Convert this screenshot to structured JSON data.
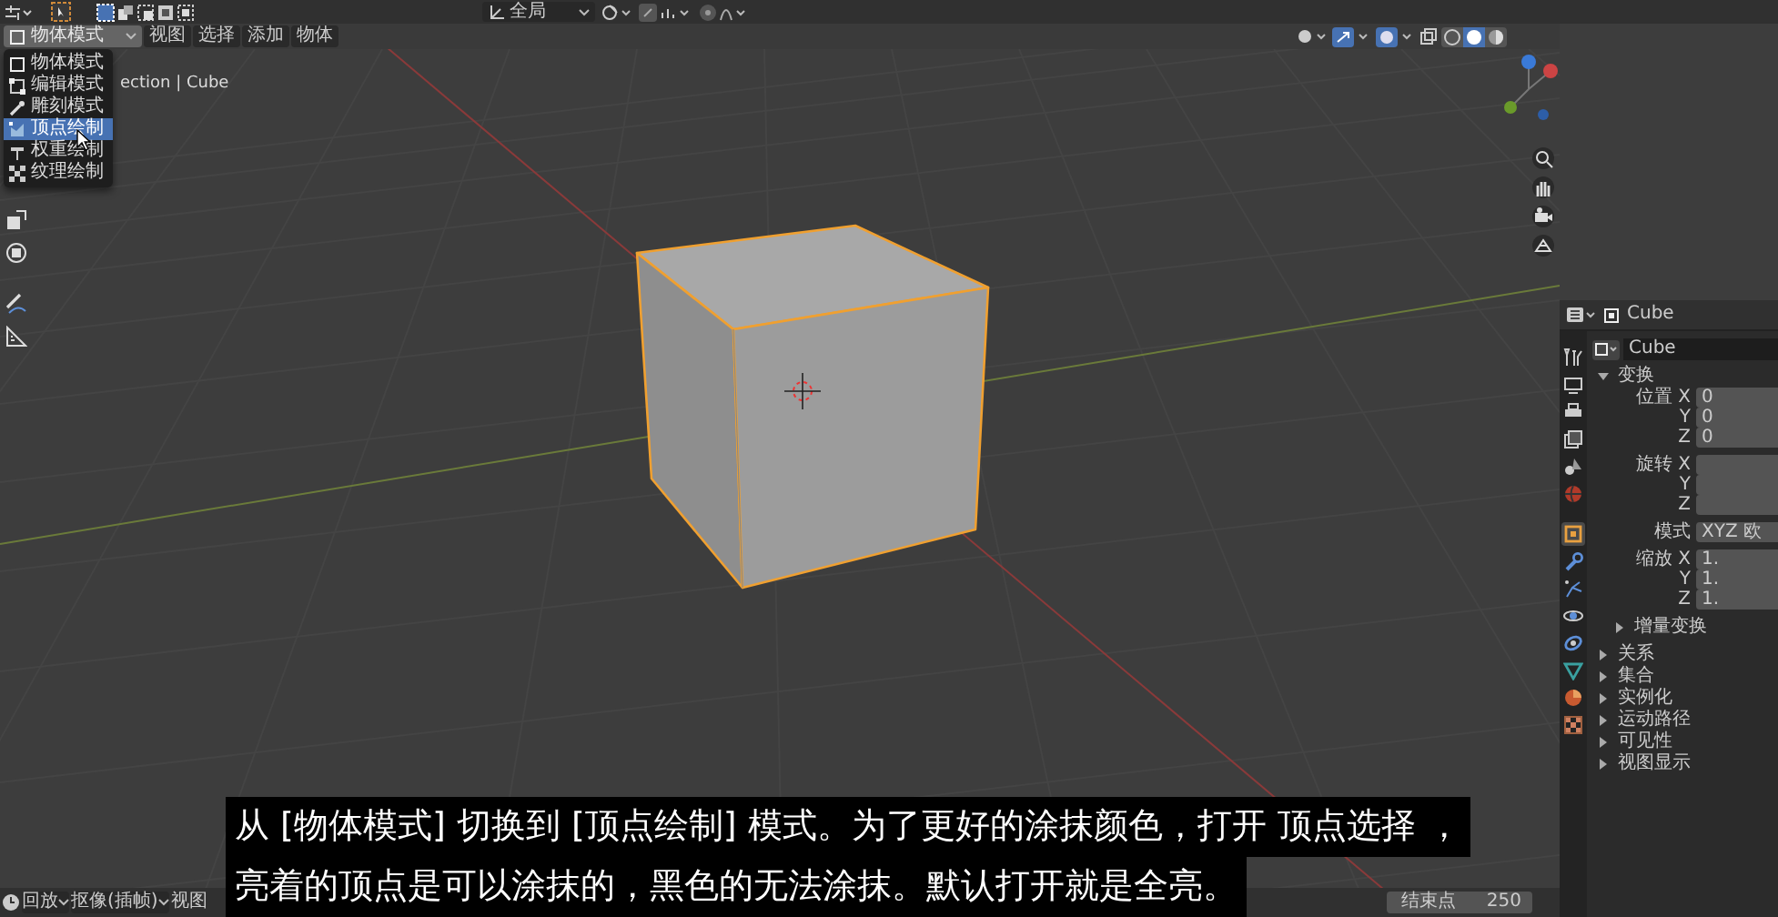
{
  "topbar": {
    "transform_orientation": "全局"
  },
  "mode_dropdown": {
    "value": "物体模式",
    "expanded": true
  },
  "mode_menu": [
    {
      "label": "物体模式",
      "kind": "object",
      "selected": false
    },
    {
      "label": "编辑模式",
      "kind": "edit",
      "selected": false
    },
    {
      "label": "雕刻模式",
      "kind": "sculpt",
      "selected": false
    },
    {
      "label": "顶点绘制",
      "kind": "vertex_paint",
      "selected": true
    },
    {
      "label": "权重绘制",
      "kind": "weight_paint",
      "selected": false
    },
    {
      "label": "纹理绘制",
      "kind": "texture_paint",
      "selected": false
    }
  ],
  "header_menus": [
    "视图",
    "选择",
    "添加",
    "物体"
  ],
  "viewport": {
    "info_text": "ection | Cube"
  },
  "properties": {
    "object_name": "Cube",
    "data_name": "Cube",
    "tabs": [
      {
        "kind": "tool",
        "selected": false
      },
      {
        "kind": "render",
        "selected": false
      },
      {
        "kind": "output",
        "selected": false
      },
      {
        "kind": "view_layer",
        "selected": false
      },
      {
        "kind": "scene",
        "selected": false
      },
      {
        "kind": "world",
        "selected": false
      },
      {
        "kind": "object",
        "selected": true
      },
      {
        "kind": "modifier",
        "selected": false
      },
      {
        "kind": "particles",
        "selected": false
      },
      {
        "kind": "physics",
        "selected": false
      },
      {
        "kind": "constraints",
        "selected": false
      },
      {
        "kind": "data",
        "selected": false
      },
      {
        "kind": "material",
        "selected": false
      },
      {
        "kind": "texture",
        "selected": false
      }
    ],
    "transform": {
      "title": "变换",
      "expanded": true,
      "groups": [
        {
          "rows": [
            {
              "label": "位置 X",
              "value": "0"
            },
            {
              "label": "Y",
              "value": "0"
            },
            {
              "label": "Z",
              "value": "0"
            }
          ]
        },
        {
          "rows": [
            {
              "label": "旋转 X"
            },
            {
              "label": "Y"
            },
            {
              "label": "Z"
            }
          ]
        },
        {
          "rows": [
            {
              "label": "模式",
              "value": "XYZ 欧"
            }
          ]
        },
        {
          "rows": [
            {
              "label": "缩放 X",
              "value": "1."
            },
            {
              "label": "Y",
              "value": "1."
            },
            {
              "label": "Z",
              "value": "1."
            }
          ]
        }
      ],
      "subpanel": {
        "title": "增量变换",
        "expanded": false
      }
    },
    "sections": [
      {
        "title": "关系",
        "expanded": false
      },
      {
        "title": "集合",
        "expanded": false
      },
      {
        "title": "实例化",
        "expanded": false
      },
      {
        "title": "运动路径",
        "expanded": false
      },
      {
        "title": "可见性",
        "expanded": false
      },
      {
        "title": "视图显示",
        "expanded": false
      }
    ]
  },
  "timeline": {
    "menus": [
      {
        "label": "回放",
        "dropdown": true
      },
      {
        "label": "抠像(插帧)",
        "dropdown": true
      },
      {
        "label": "视图",
        "dropdown": false
      }
    ],
    "end_label": "结束点",
    "end_value": "250"
  },
  "subtitle": {
    "lines": [
      "从 [物体模式] 切换到 [顶点绘制] 模式。为了更好的涂抹颜色，打开 顶点选择 ，",
      "亮着的顶点是可以涂抹的，黑色的无法涂抹。默认打开就是全亮。"
    ]
  }
}
